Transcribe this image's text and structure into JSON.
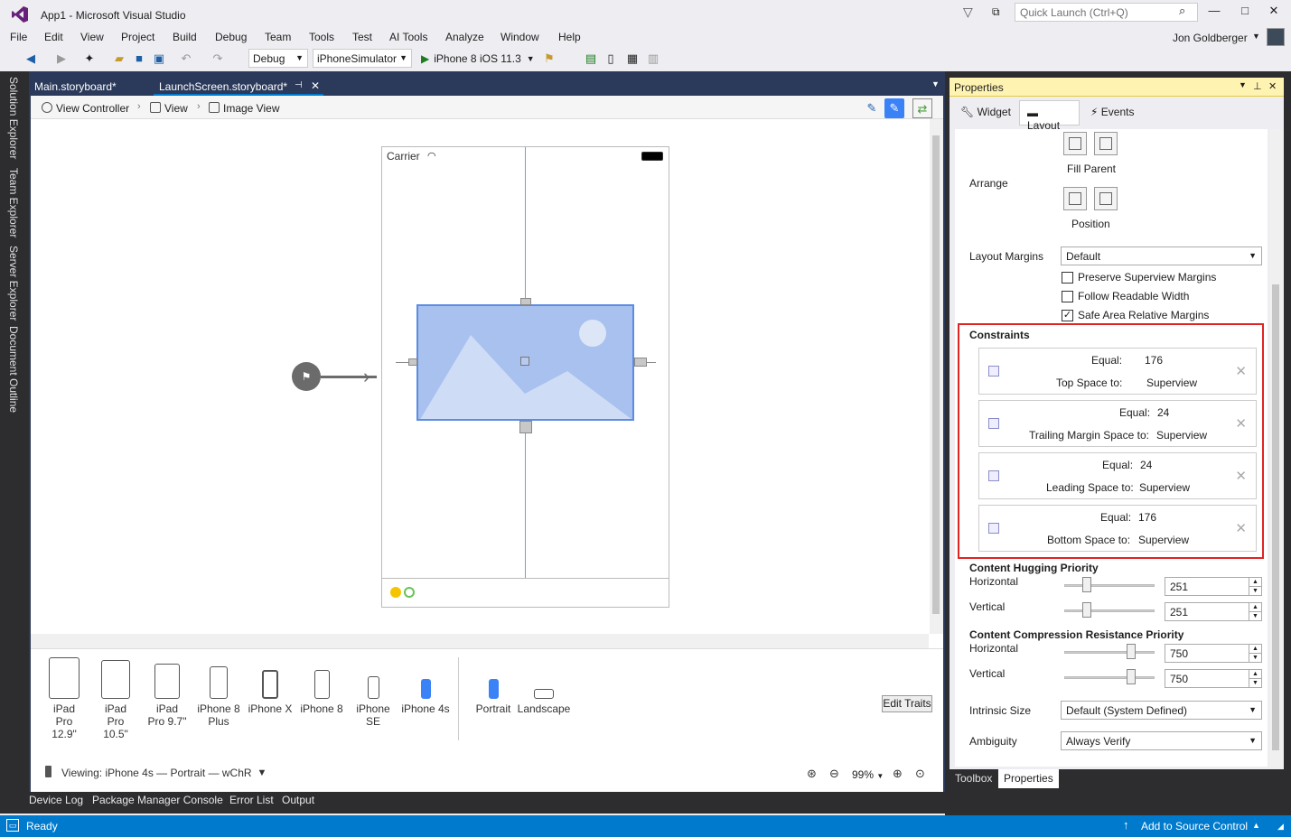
{
  "window": {
    "title": "App1 - Microsoft Visual Studio",
    "quick_launch_placeholder": "Quick Launch (Ctrl+Q)",
    "user": "Jon Goldberger"
  },
  "menu": [
    "File",
    "Edit",
    "View",
    "Project",
    "Build",
    "Debug",
    "Team",
    "Tools",
    "Test",
    "AI Tools",
    "Analyze",
    "Window",
    "Help"
  ],
  "toolbar": {
    "config": "Debug",
    "platform": "iPhoneSimulator",
    "run_target": "iPhone 8 iOS 11.3"
  },
  "left_tabs": [
    "Solution Explorer",
    "Team Explorer",
    "Server Explorer",
    "Document Outline"
  ],
  "doc_tabs": [
    {
      "label": "Main.storyboard*",
      "active": false
    },
    {
      "label": "LaunchScreen.storyboard*",
      "active": true
    }
  ],
  "breadcrumb": [
    "View Controller",
    "View",
    "Image View"
  ],
  "phone": {
    "carrier": "Carrier"
  },
  "devices": [
    {
      "name": "iPad Pro 12.9\"",
      "selected": false
    },
    {
      "name": "iPad Pro 10.5\"",
      "selected": false
    },
    {
      "name": "iPad Pro 9.7\"",
      "selected": false
    },
    {
      "name": "iPhone 8 Plus",
      "selected": false
    },
    {
      "name": "iPhone X",
      "selected": false
    },
    {
      "name": "iPhone 8",
      "selected": false
    },
    {
      "name": "iPhone SE",
      "selected": false
    },
    {
      "name": "iPhone 4s",
      "selected": true
    }
  ],
  "orientations": [
    {
      "name": "Portrait",
      "selected": true
    },
    {
      "name": "Landscape",
      "selected": false
    }
  ],
  "edit_traits": "Edit Traits",
  "viewing": "Viewing: iPhone 4s — Portrait — wChR",
  "zoom": "99%",
  "bottom_tabs": [
    "Device Log",
    "Package Manager Console",
    "Error List",
    "Output"
  ],
  "status": {
    "ready": "Ready",
    "source_control": "Add to Source Control"
  },
  "properties": {
    "title": "Properties",
    "tabs": [
      "Widget",
      "Layout",
      "Events"
    ],
    "selected_tab": "Layout",
    "fill_parent": "Fill Parent",
    "arrange": "Arrange",
    "position": "Position",
    "layout_margins_label": "Layout Margins",
    "layout_margins_value": "Default",
    "checkboxes": [
      {
        "label": "Preserve Superview Margins",
        "checked": false
      },
      {
        "label": "Follow Readable Width",
        "checked": false
      },
      {
        "label": "Safe Area Relative Margins",
        "checked": true
      }
    ],
    "constraints_title": "Constraints",
    "constraints": [
      {
        "relation": "Equal:",
        "value": "176",
        "kind": "Top Space to:",
        "target": "Superview"
      },
      {
        "relation": "Equal:",
        "value": "24",
        "kind": "Trailing Margin Space to:",
        "target": "Superview"
      },
      {
        "relation": "Equal:",
        "value": "24",
        "kind": "Leading Space to:",
        "target": "Superview"
      },
      {
        "relation": "Equal:",
        "value": "176",
        "kind": "Bottom Space to:",
        "target": "Superview"
      }
    ],
    "hugging_title": "Content Hugging Priority",
    "hugging": {
      "horizontal_label": "Horizontal",
      "horizontal": "251",
      "vertical_label": "Vertical",
      "vertical": "251"
    },
    "compression_title": "Content Compression Resistance Priority",
    "compression": {
      "horizontal_label": "Horizontal",
      "horizontal": "750",
      "vertical_label": "Vertical",
      "vertical": "750"
    },
    "intrinsic_label": "Intrinsic Size",
    "intrinsic_value": "Default (System Defined)",
    "ambiguity_label": "Ambiguity",
    "ambiguity_value": "Always Verify",
    "bottom_tabs": [
      "Toolbox",
      "Properties"
    ]
  },
  "colors": {
    "accent": "#007acc",
    "highlight": "#e02424",
    "selection_blue": "#3b82f6"
  }
}
